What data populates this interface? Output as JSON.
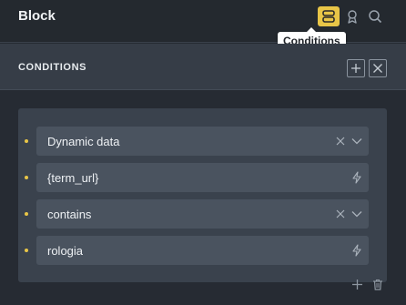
{
  "header": {
    "title": "Block",
    "tooltip": "Conditions"
  },
  "section": {
    "title": "CONDITIONS"
  },
  "conditions": [
    {
      "value": "Dynamic data",
      "kind": "select"
    },
    {
      "value": "{term_url}",
      "kind": "dynamic"
    },
    {
      "value": "contains",
      "kind": "select"
    },
    {
      "value": "rologia",
      "kind": "dynamic"
    }
  ],
  "colors": {
    "accent": "#e8c547",
    "panel": "#262b33",
    "field": "#4a535f"
  }
}
